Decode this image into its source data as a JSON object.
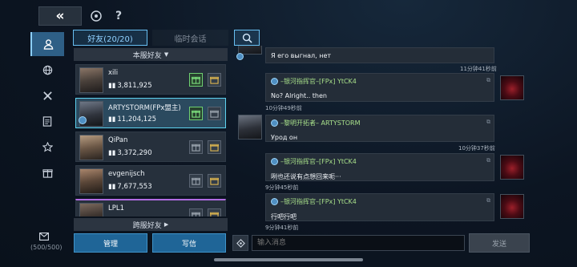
{
  "topbar": {
    "back_icon": "double-chevron-left",
    "refresh_icon": "refresh",
    "help_label": "?"
  },
  "rail": {
    "items": [
      {
        "name": "friends",
        "icon": "person-icon",
        "active": true
      },
      {
        "name": "world",
        "icon": "globe-icon",
        "active": false
      },
      {
        "name": "alliance",
        "icon": "crossed-swords-icon",
        "active": false
      },
      {
        "name": "notes",
        "icon": "list-icon",
        "active": false
      },
      {
        "name": "favorites",
        "icon": "star-icon",
        "active": false
      },
      {
        "name": "gifts",
        "icon": "gift-icon",
        "active": false
      }
    ]
  },
  "mail": {
    "count": "(500/500)"
  },
  "tabs": {
    "friends": "好友(20/20)",
    "temp": "临时会话"
  },
  "friend_groups": {
    "server": "本服好友",
    "cross": "跨服好友"
  },
  "friends": [
    {
      "name": "xili",
      "score": "3,811,925",
      "selected": false,
      "online": false,
      "gift_active": true
    },
    {
      "name": "ARTYSTORM(FPx盟主)",
      "score": "11,204,125",
      "selected": true,
      "online": true,
      "gift_active": true
    },
    {
      "name": "QiPan",
      "score": "3,372,290",
      "selected": false,
      "online": false,
      "gift_active": false
    },
    {
      "name": "evgenijsch",
      "score": "7,677,553",
      "selected": false,
      "online": false,
      "gift_active": false
    },
    {
      "name": "LPL1",
      "score": "",
      "selected": false,
      "online": false,
      "gift_active": false
    }
  ],
  "buttons": {
    "manage": "管理",
    "write": "写信",
    "send": "发送"
  },
  "input": {
    "placeholder": "输入消息"
  },
  "chat": [
    {
      "text": "Я его выгнал, нет",
      "time": "11分钟41秒前",
      "side": "partial"
    },
    {
      "sender": "–银河指挥官–[FPx] YtCK4",
      "text": "No? Alright.. then",
      "time": "10分钟49秒前",
      "avatar": "red"
    },
    {
      "sender": "–黎明开拓者– ARTYSTORM",
      "text": "Урод он",
      "time": "10分钟37秒前",
      "avatar": "dark"
    },
    {
      "sender": "–银河指挥官–[FPx] YtCK4",
      "text": "咧也还说有点想回来呃···",
      "time": "9分钟45秒前",
      "avatar": "red"
    },
    {
      "sender": "–银河指挥官–[FPx] YtCK4",
      "text": "行吧行吧",
      "time": "9分钟41秒前",
      "avatar": "red"
    }
  ],
  "colors": {
    "accent": "#67bff2",
    "sender_green": "#a8e08a",
    "panel": "#242d38"
  }
}
